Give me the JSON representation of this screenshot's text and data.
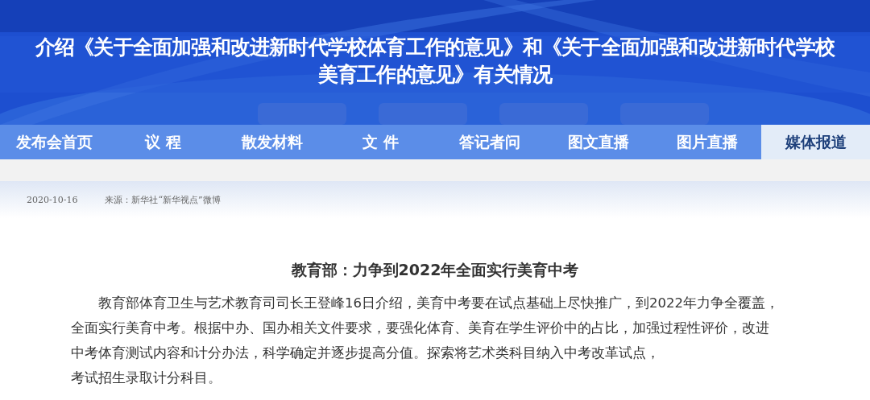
{
  "banner": {
    "title_lines": [
      "介绍《关于全面加强和改进新时代学校体育工作的意见》和《关于全面加强和改进新时代学校",
      "美育工作的意见》有关情况"
    ]
  },
  "tabs": [
    {
      "label": "发布会首页",
      "selected": false
    },
    {
      "label": "议 程",
      "selected": false
    },
    {
      "label": "散发材料",
      "selected": false
    },
    {
      "label": "文 件",
      "selected": false
    },
    {
      "label": "答记者问",
      "selected": false
    },
    {
      "label": "图文直播",
      "selected": false
    },
    {
      "label": "图片直播",
      "selected": false
    },
    {
      "label": "媒体报道",
      "selected": true
    }
  ],
  "meta": {
    "date": "2020-10-16",
    "source": "来源：新华社“新华视点”微博"
  },
  "article": {
    "headline": "教育部：力争到2022年全面实行美育中考",
    "lines": [
      "教育部体育卫生与艺术教育司司长王登峰16日介绍，美育中考要在试点基础上尽快推广，到2022年力争全覆盖，",
      "全面实行美育中考。根据中办、国办相关文件要求，要强化体育、美育在学生评价中的占比，加强过程性评价，改进",
      "中考体育测试内容和计分办法，科学确定并逐步提高分值。探索将艺术类科目纳入中考改革试点，",
      "考试招生录取计分科目。"
    ]
  }
}
